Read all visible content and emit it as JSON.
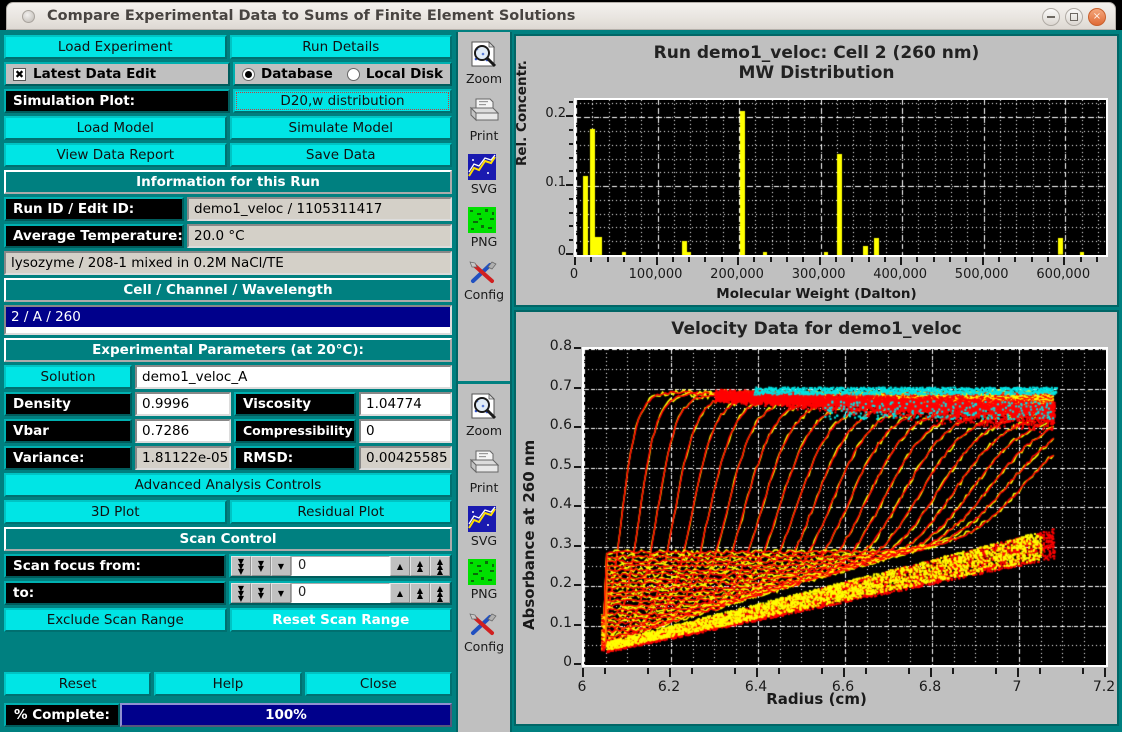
{
  "window": {
    "title": "Compare Experimental Data to Sums of Finite Element Solutions",
    "minimize_label": "",
    "maximize_label": "",
    "close_label": "×"
  },
  "controls": {
    "load_experiment": "Load Experiment",
    "run_details": "Run Details",
    "latest_data_edit": "Latest Data Edit",
    "latest_data_edit_checked": "✖",
    "source_database": "Database",
    "source_local_disk": "Local Disk",
    "simulation_plot_label": "Simulation Plot:",
    "simulation_plot_value": "D20,w distribution",
    "load_model": "Load Model",
    "simulate_model": "Simulate Model",
    "view_data_report": "View Data Report",
    "save_data": "Save Data",
    "information_banner": "Information for this Run",
    "run_id_label": "Run ID / Edit ID:",
    "run_id_value": "demo1_veloc / 1105311417",
    "avg_temp_label": "Average Temperature:",
    "avg_temp_value": "20.0 °C",
    "description": "lysozyme / 208-1 mixed in 0.2M NaCl/TE",
    "cell_channel_banner": "Cell / Channel / Wavelength",
    "cell_channel_selected": "2 / A / 260",
    "experimental_params_banner": "Experimental Parameters (at 20°C):",
    "solution_label": "Solution",
    "solution_value": "demo1_veloc_A",
    "density_label": "Density",
    "density_value": "0.9996",
    "viscosity_label": "Viscosity",
    "viscosity_value": "1.04774",
    "vbar_label": "Vbar",
    "vbar_value": "0.7286",
    "compressibility_label": "Compressibility",
    "compressibility_value": "0",
    "variance_label": "Variance:",
    "variance_value": "1.81122e-05",
    "rmsd_label": "RMSD:",
    "rmsd_value": "0.00425585",
    "advanced_analysis": "Advanced Analysis Controls",
    "plot_3d": "3D Plot",
    "residual_plot": "Residual Plot",
    "scan_control_banner": "Scan Control",
    "scan_from_label": "Scan focus from:",
    "scan_from_value": "0",
    "scan_to_label": "to:",
    "scan_to_value": "0",
    "exclude_scan_range": "Exclude Scan Range",
    "reset_scan_range": "Reset Scan Range",
    "reset": "Reset",
    "help": "Help",
    "close": "Close",
    "percent_complete_label": "% Complete:",
    "percent_complete_value": "100%"
  },
  "iconbar": {
    "top": [
      {
        "icon": "zoom-icon",
        "label": "Zoom"
      },
      {
        "icon": "print-icon",
        "label": "Print"
      },
      {
        "icon": "svg-icon",
        "label": "SVG"
      },
      {
        "icon": "png-icon",
        "label": "PNG"
      },
      {
        "icon": "config-icon",
        "label": "Config"
      }
    ],
    "bottom": [
      {
        "icon": "zoom-icon",
        "label": "Zoom"
      },
      {
        "icon": "print-icon",
        "label": "Print"
      },
      {
        "icon": "svg-icon",
        "label": "SVG"
      },
      {
        "icon": "png-icon",
        "label": "PNG"
      },
      {
        "icon": "config-icon",
        "label": "Config"
      }
    ]
  },
  "colors": {
    "accent_cyan": "#00e5e5",
    "teal": "#008080",
    "plot_bg": "#000000",
    "bar_yellow": "#ffff00",
    "data_red": "#ff0000",
    "data_cyan": "#00e5e5",
    "progress_blue": "#00008b",
    "select_blue": "#00008b"
  },
  "chart_data": [
    {
      "type": "bar",
      "title": "Run demo1_veloc: Cell 2 (260 nm)",
      "subtitle": "MW Distribution",
      "xlabel": "Molecular Weight (Dalton)",
      "ylabel": "Rel. Concentr.",
      "xlim": [
        0,
        650000
      ],
      "ylim": [
        0,
        0.225
      ],
      "xticks": [
        0,
        100000,
        200000,
        300000,
        400000,
        500000,
        600000
      ],
      "xticklabels": [
        "0",
        "100,000",
        "200,000",
        "300,000",
        "400,000",
        "500,000",
        "600,000"
      ],
      "yticks": [
        0,
        0.1,
        0.2
      ],
      "yticklabels": [
        "0",
        "0.1",
        "0.2"
      ],
      "grid": true,
      "bar_color": "#ffff00",
      "x": [
        11500,
        20500,
        23500,
        59000,
        133500,
        139000,
        204500,
        232000,
        306000,
        323000,
        355000,
        369000,
        594000,
        620000
      ],
      "values": [
        0.115,
        0.183,
        0.026,
        0.004,
        0.021,
        0.004,
        0.209,
        0.004,
        0.004,
        0.147,
        0.013,
        0.025,
        0.024,
        0.004
      ]
    },
    {
      "type": "scatter",
      "title": "Velocity Data for demo1_veloc",
      "xlabel": "Radius (cm)",
      "ylabel": "Absorbance at 260 nm",
      "xlim": [
        6.0,
        7.2
      ],
      "ylim": [
        0,
        0.8
      ],
      "xticks": [
        6,
        6.2,
        6.4,
        6.6,
        6.8,
        7,
        7.2
      ],
      "xticklabels": [
        "6",
        "6.2",
        "6.4",
        "6.6",
        "6.8",
        "7",
        "7.2"
      ],
      "yticks": [
        0,
        0.1,
        0.2,
        0.3,
        0.4,
        0.5,
        0.6,
        0.7,
        0.8
      ],
      "yticklabels": [
        "0",
        "0.1",
        "0.2",
        "0.3",
        "0.4",
        "0.5",
        "0.6",
        "0.7",
        "0.8"
      ],
      "grid": true,
      "series": [
        {
          "name": "experimental-data",
          "color": "#ffff00"
        },
        {
          "name": "fitted-model",
          "color": "#ff0000"
        },
        {
          "name": "plateau-overlay",
          "color": "#00e5e5"
        }
      ],
      "meniscus": 6.04,
      "data_end": 7.08,
      "n_scans": 24,
      "plateau_absorbance": 0.69,
      "baseline_absorbance": 0.03
    }
  ]
}
